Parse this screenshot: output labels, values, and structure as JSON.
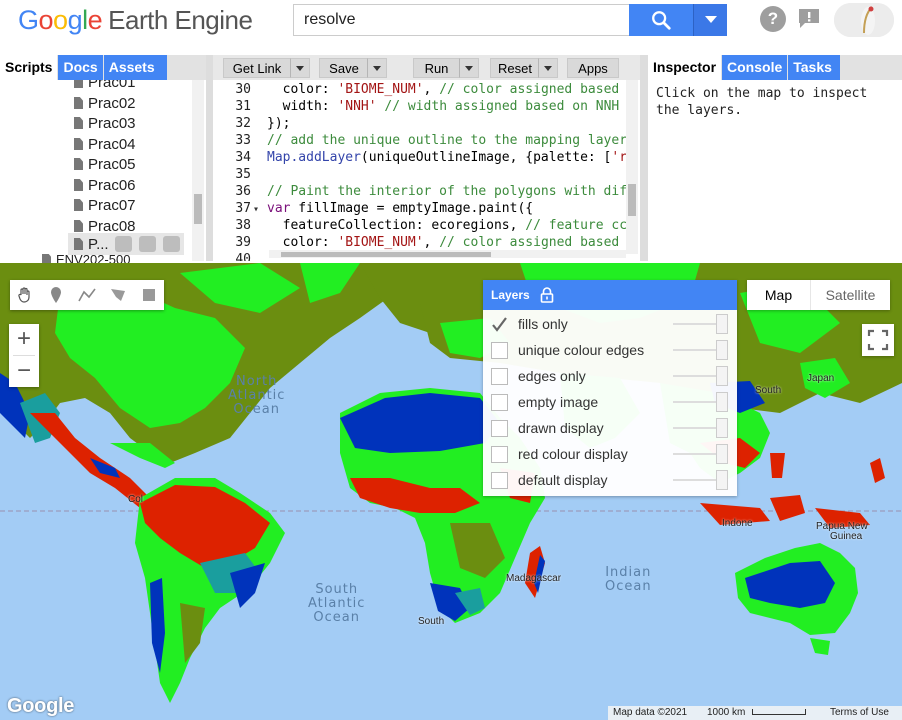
{
  "header": {
    "logo_google": "Google",
    "logo_product": "Earth Engine",
    "search_value": "resolve"
  },
  "left_panel": {
    "tabs": [
      "Scripts",
      "Docs",
      "Assets"
    ],
    "files": [
      "Prac01",
      "Prac02",
      "Prac03",
      "Prac04",
      "Prac05",
      "Prac06",
      "Prac07",
      "Prac08",
      "P..."
    ],
    "partial_item": "ENV202-500"
  },
  "code_editor": {
    "buttons": [
      "Get Link",
      "Save",
      "Run",
      "Reset",
      "Apps"
    ],
    "lines": [
      {
        "n": "30",
        "text": "  color: 'BIOME_NUM', // color assigned based"
      },
      {
        "n": "31",
        "text": "  width: 'NNH' // width assigned based on NNH"
      },
      {
        "n": "32",
        "text": "});"
      },
      {
        "n": "33",
        "text": "// add the unique outline to the mapping layer"
      },
      {
        "n": "34",
        "text": "Map.addLayer(uniqueOutlineImage, {palette: ['r"
      },
      {
        "n": "35",
        "text": ""
      },
      {
        "n": "36",
        "text": "// Paint the interior of the polygons with dif"
      },
      {
        "n": "37",
        "text": "var fillImage = emptyImage.paint({"
      },
      {
        "n": "38",
        "text": "  featureCollection: ecoregions, // feature cc"
      },
      {
        "n": "39",
        "text": "  color: 'BIOME_NUM', // color assigned based"
      },
      {
        "n": "40",
        "text": ""
      }
    ]
  },
  "right_panel": {
    "tabs": [
      "Inspector",
      "Console",
      "Tasks"
    ],
    "inspector_text": "Click on the map to inspect\nthe layers."
  },
  "map": {
    "layers_title": "Layers",
    "layers": [
      {
        "name": "fills only",
        "checked": true
      },
      {
        "name": "unique colour edges",
        "checked": false
      },
      {
        "name": "edges only",
        "checked": false
      },
      {
        "name": "empty image",
        "checked": false
      },
      {
        "name": "drawn display",
        "checked": false
      },
      {
        "name": "red colour display",
        "checked": false
      },
      {
        "name": "default display",
        "checked": false
      }
    ],
    "map_type": {
      "map": "Map",
      "satellite": "Satellite"
    },
    "zoom_in": "+",
    "zoom_out": "−",
    "ocean_labels": {
      "north_atlantic": "North\nAtlantic\nOcean",
      "south_atlantic": "South\nAtlantic\nOcean",
      "indian": "Indian\nOcean"
    },
    "place_labels": [
      "Japan",
      "South",
      "Indone",
      "Papua New",
      "Guinea",
      "Madagascar",
      "South",
      "Col"
    ],
    "google_logo": "Google",
    "attribution": {
      "map_data": "Map data ©2021",
      "scale": "1000 km",
      "terms": "Terms of Use"
    }
  },
  "colors": {
    "accent_blue": "#4285f4",
    "biome_red": "#dd2200",
    "biome_green": "#22ee22",
    "biome_olive": "#6b8e10",
    "biome_navy": "#0033bb",
    "biome_teal": "#1a9e9e",
    "ocean": "#a3ccf5"
  }
}
